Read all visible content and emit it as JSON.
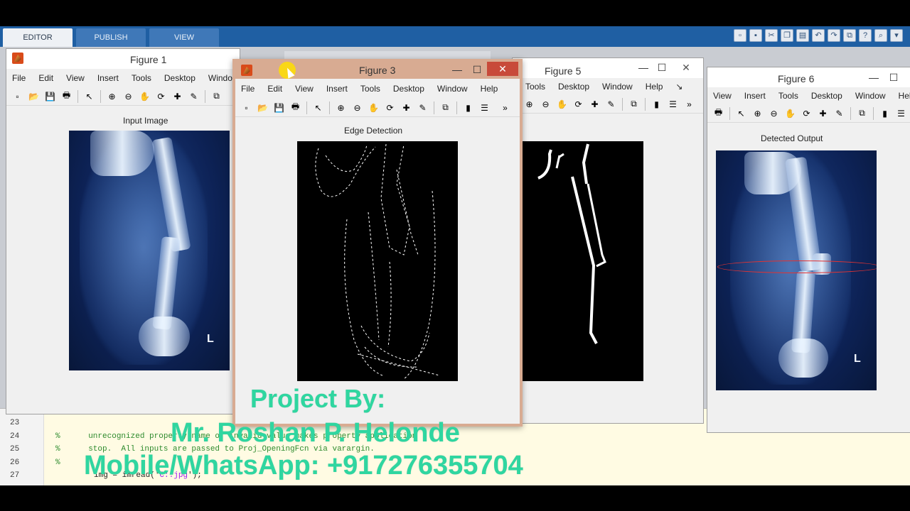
{
  "ribbon": {
    "tabs": [
      {
        "label": "EDITOR",
        "active": true
      },
      {
        "label": "PUBLISH",
        "active": false
      },
      {
        "label": "VIEW",
        "active": false
      }
    ],
    "quick_access": [
      "new-icon",
      "save-icon",
      "cut-icon",
      "copy-icon",
      "paste-icon",
      "undo-icon",
      "redo-icon",
      "switch-windows-icon",
      "help-icon",
      "search-icon",
      "collapse-icon"
    ]
  },
  "menus": {
    "full": [
      "File",
      "Edit",
      "View",
      "Insert",
      "Tools",
      "Desktop",
      "Window",
      "Help"
    ],
    "fig1": [
      "File",
      "Edit",
      "View",
      "Insert",
      "Tools",
      "Desktop",
      "Window"
    ],
    "fig5": [
      "Tools",
      "Desktop",
      "Window",
      "Help"
    ],
    "fig6": [
      "View",
      "Insert",
      "Tools",
      "Desktop",
      "Window",
      "Help"
    ]
  },
  "figures": {
    "fig1": {
      "title": "Figure 1",
      "axes_title": "Input Image",
      "close": "✕",
      "side_mark": "L"
    },
    "fig3": {
      "title": "Figure 3",
      "axes_title": "Edge Detection",
      "minimize": "—",
      "maximize": "☐",
      "close": "✕"
    },
    "fig5": {
      "title": "Figure 5",
      "minimize": "—",
      "maximize": "☐",
      "close": "✕",
      "menu_overflow": "↘"
    },
    "fig6": {
      "title": "Figure 6",
      "axes_title": "Detected Output",
      "minimize": "—",
      "maximize": "☐",
      "side_mark": "L"
    }
  },
  "editor": {
    "lines": [
      {
        "num": "23",
        "text": ""
      },
      {
        "num": "24",
        "text": "%      unrecognized property name or invalid value makes property application"
      },
      {
        "num": "25",
        "text": "%      stop.  All inputs are passed to Proj_OpeningFcn via varargin."
      },
      {
        "num": "26",
        "text": "%"
      },
      {
        "num": "27",
        "text": "img = imread('",
        "string": "C:.jpg",
        "tail": "');"
      }
    ]
  },
  "overlay": {
    "line1": "Project By:",
    "line2": "Mr. Roshan P. Helonde",
    "line3": "Mobile/WhatsApp: +917276355704",
    "color": "#2fd6a0"
  }
}
